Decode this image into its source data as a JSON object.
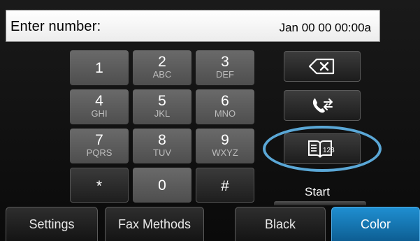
{
  "entry": {
    "label": "Enter number:",
    "datetime": "Jan 00 00 00:00a"
  },
  "keypad": [
    {
      "digit": "1",
      "letters": ""
    },
    {
      "digit": "2",
      "letters": "ABC"
    },
    {
      "digit": "3",
      "letters": "DEF"
    },
    {
      "digit": "4",
      "letters": "GHI"
    },
    {
      "digit": "5",
      "letters": "JKL"
    },
    {
      "digit": "6",
      "letters": "MNO"
    },
    {
      "digit": "7",
      "letters": "PQRS"
    },
    {
      "digit": "8",
      "letters": "TUV"
    },
    {
      "digit": "9",
      "letters": "WXYZ"
    },
    {
      "digit": "*",
      "letters": ""
    },
    {
      "digit": "0",
      "letters": ""
    },
    {
      "digit": "#",
      "letters": ""
    }
  ],
  "side_buttons": {
    "backspace_icon": "backspace-icon",
    "redial_icon": "redial-phone-icon",
    "phonebook_icon": "phonebook-icon",
    "phonebook_icon_text": "123",
    "start_label": "Start"
  },
  "tabs": {
    "settings": "Settings",
    "fax_methods": "Fax Methods",
    "black": "Black",
    "color": "Color"
  },
  "colors": {
    "accent_blue": "#1a7fc1",
    "highlight_ring": "#5aa7d6"
  }
}
